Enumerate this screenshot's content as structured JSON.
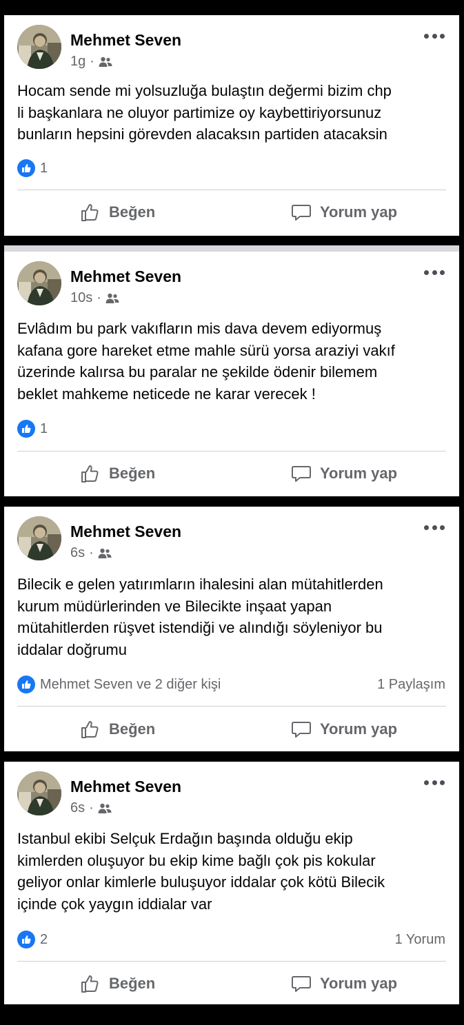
{
  "posts": [
    {
      "author": "Mehmet Seven",
      "time": "1g",
      "separator": "·",
      "audience_icon": "friends-icon",
      "text": "Hocam sende mi yolsuzluğa bulaştın değermi bizim chp\nli başkanlara ne oluyor partimize oy kaybettiriyorsunuz\nbunların hepsini görevden alacaksın partiden atacaksin",
      "reaction_summary": "1",
      "reaction_right": "",
      "like_label": "Beğen",
      "comment_label": "Yorum yap"
    },
    {
      "author": "Mehmet Seven",
      "time": "10s",
      "separator": "·",
      "audience_icon": "friends-icon",
      "text": "Evlâdım bu park vakıfların mis dava devem ediyormuş\nkafana gore hareket etme mahle sürü yorsa araziyi vakıf\nüzerinde kalırsa bu paralar ne şekilde ödenir bilemem\nbeklet mahkeme neticede ne karar verecek !",
      "reaction_summary": "1",
      "reaction_right": "",
      "like_label": "Beğen",
      "comment_label": "Yorum yap"
    },
    {
      "author": "Mehmet Seven",
      "time": "6s",
      "separator": "·",
      "audience_icon": "friends-icon",
      "text": "Bilecik e gelen yatırımların ihalesini alan mütahitlerden\nkurum müdürlerinden ve Bilecikte inşaat yapan\nmütahitlerden rüşvet istendiği ve alındığı söyleniyor bu\niddalar doğrumu",
      "reaction_summary": "Mehmet Seven ve 2 diğer kişi",
      "reaction_right": "1 Paylaşım",
      "like_label": "Beğen",
      "comment_label": "Yorum yap"
    },
    {
      "author": "Mehmet Seven",
      "time": "6s",
      "separator": "·",
      "audience_icon": "friends-icon",
      "text": "Istanbul ekibi Selçuk Erdağın başında olduğu ekip\nkimlerden oluşuyor  bu ekip kime bağlı çok pis kokular\ngeliyor onlar kimlerle buluşuyor iddalar çok kötü Bilecik\niçinde çok yaygın iddialar var",
      "reaction_summary": "2",
      "reaction_right": "1 Yorum",
      "like_label": "Beğen",
      "comment_label": "Yorum yap"
    }
  ],
  "colors": {
    "like_blue": "#1877f2",
    "secondary_text": "#65676b",
    "primary_text": "#050505",
    "divider": "#ced0d4"
  }
}
